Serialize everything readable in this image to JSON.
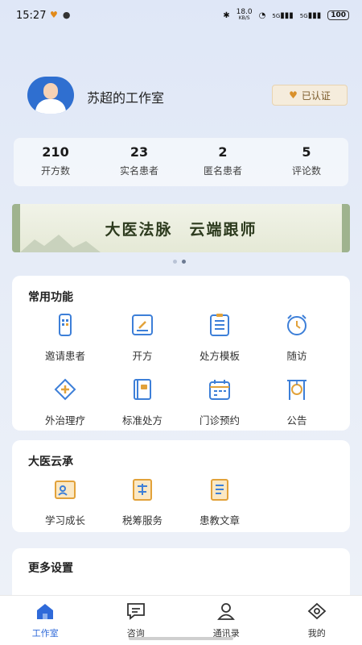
{
  "status_bar": {
    "time": "15:27",
    "network_speed": "18.0",
    "speed_unit": "KB/S",
    "signal1": "5G",
    "signal2": "5G",
    "battery": "100"
  },
  "profile": {
    "name": "苏超的工作室",
    "cert_label": "已认证"
  },
  "stats": [
    {
      "value": "210",
      "label": "开方数"
    },
    {
      "value": "23",
      "label": "实名患者"
    },
    {
      "value": "2",
      "label": "匿名患者"
    },
    {
      "value": "5",
      "label": "评论数"
    }
  ],
  "banner": {
    "text": "大医法脉　云端跟师"
  },
  "common_functions": {
    "title": "常用功能",
    "items": [
      {
        "label": "邀请患者",
        "icon": "qr-phone-icon"
      },
      {
        "label": "开方",
        "icon": "prescription-edit-icon"
      },
      {
        "label": "处方模板",
        "icon": "template-list-icon"
      },
      {
        "label": "随访",
        "icon": "alarm-clock-icon"
      },
      {
        "label": "外治理疗",
        "icon": "physio-cross-icon"
      },
      {
        "label": "标准处方",
        "icon": "standard-book-icon"
      },
      {
        "label": "门诊预约",
        "icon": "calendar-icon"
      },
      {
        "label": "公告",
        "icon": "announcement-gong-icon"
      }
    ]
  },
  "daiyi": {
    "title": "大医云承",
    "items": [
      {
        "label": "学习成长",
        "icon": "learning-icon"
      },
      {
        "label": "税筹服务",
        "icon": "tax-service-icon"
      },
      {
        "label": "患教文章",
        "icon": "article-icon"
      }
    ]
  },
  "more_settings": {
    "title": "更多设置"
  },
  "tabbar": [
    {
      "label": "工作室",
      "icon": "home-icon",
      "active": true
    },
    {
      "label": "咨询",
      "icon": "message-icon",
      "active": false
    },
    {
      "label": "通讯录",
      "icon": "contacts-icon",
      "active": false
    },
    {
      "label": "我的",
      "icon": "profile-icon",
      "active": false
    }
  ],
  "colors": {
    "accent": "#2f6ad9",
    "icon_blue": "#3d7fd8",
    "icon_orange": "#e2a23a",
    "cert_bg": "#f5ecdc"
  }
}
